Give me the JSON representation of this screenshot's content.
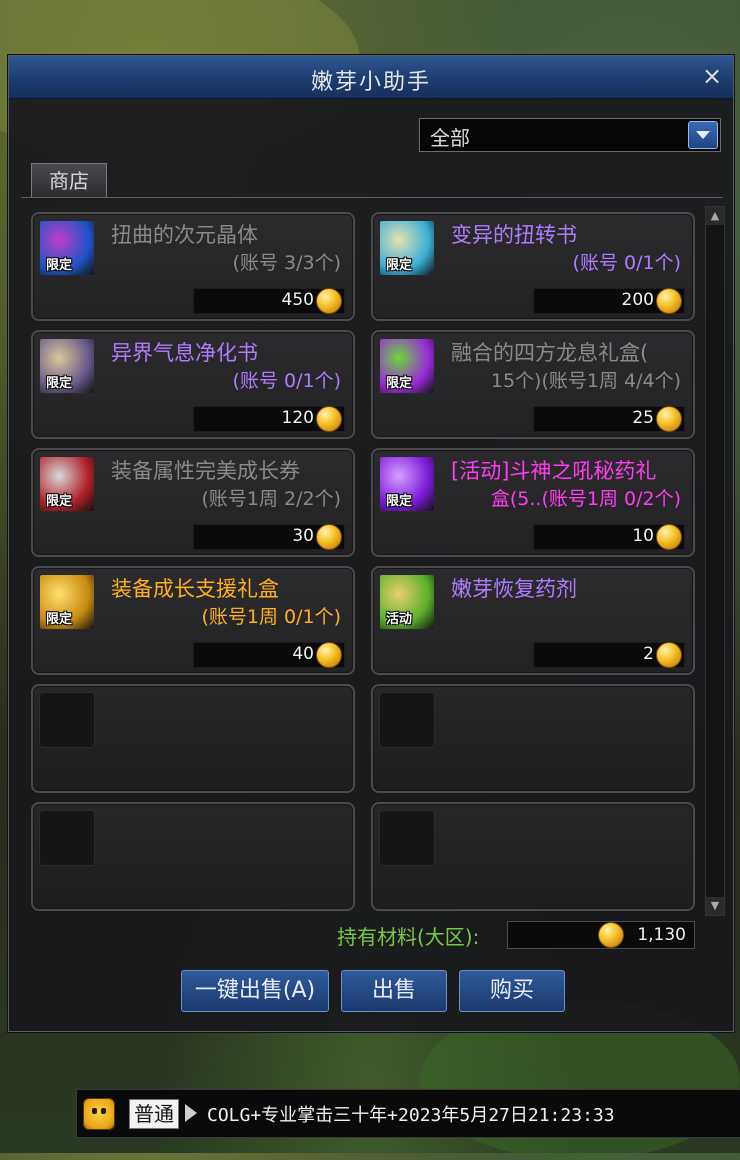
{
  "window": {
    "title": "嫩芽小助手",
    "close_glyph": "×",
    "filter": {
      "selected": "全部"
    },
    "tabs": [
      {
        "label": "商店",
        "active": true
      }
    ],
    "items": [
      {
        "name": "扭曲的次元晶体",
        "limit": "(账号 3/3个)",
        "price": "450",
        "badge": "限定",
        "name_color": "#8a8a8a",
        "icon_colors": [
          "#1f55c8",
          "#c03cc8"
        ],
        "state": "disabled"
      },
      {
        "name": "变异的扭转书",
        "limit": "(账号 0/1个)",
        "price": "200",
        "badge": "限定",
        "name_color": "#b07cff",
        "icon_colors": [
          "#3ab0d8",
          "#e8e0b0"
        ],
        "state": "available"
      },
      {
        "name": "异界气息净化书",
        "limit": "(账号 0/1个)",
        "price": "120",
        "badge": "限定",
        "name_color": "#b07cff",
        "icon_colors": [
          "#6a5a8a",
          "#d8c89a"
        ],
        "state": "available"
      },
      {
        "name": "融合的四方龙息礼盒(",
        "limit": "15个)(账号1周 4/4个)",
        "price": "25",
        "badge": "限定",
        "name_color": "#8a8a8a",
        "icon_colors": [
          "#9a2ad8",
          "#6ad83a"
        ],
        "state": "disabled"
      },
      {
        "name": "装备属性完美成长券",
        "limit": "(账号1周 2/2个)",
        "price": "30",
        "badge": "限定",
        "name_color": "#8a8a8a",
        "icon_colors": [
          "#b0202a",
          "#d8d8d8"
        ],
        "state": "disabled"
      },
      {
        "name": "[活动]斗神之吼秘药礼",
        "limit": "盒(5..(账号1周 0/2个)",
        "price": "10",
        "badge": "限定",
        "name_color": "#ff3cf0",
        "icon_colors": [
          "#7a1ad8",
          "#d8a0ff"
        ],
        "state": "available"
      },
      {
        "name": "装备成长支援礼盒",
        "limit": "(账号1周 0/1个)",
        "price": "40",
        "badge": "限定",
        "name_color": "#ffb020",
        "icon_colors": [
          "#c88a10",
          "#ffe070"
        ],
        "state": "available"
      },
      {
        "name": "嫩芽恢复药剂",
        "limit": "",
        "price": "2",
        "badge": "活动",
        "name_color": "#b07cff",
        "icon_colors": [
          "#5ab02a",
          "#e8d070"
        ],
        "state": "available"
      }
    ],
    "empty_slots": 4,
    "material": {
      "label": "持有材料(大区):",
      "value": "1,130"
    },
    "buttons": {
      "sell_all": "一键出售(A)",
      "sell": "出售",
      "buy": "购买"
    }
  },
  "chat": {
    "channel": "普通",
    "input_value": "COLG+专业掌击三十年+2023年5月27日21:23:33"
  },
  "colors": {
    "title_bar": "#1c3c70",
    "button": "#1b3a6e",
    "material_label": "#7ac84a"
  }
}
